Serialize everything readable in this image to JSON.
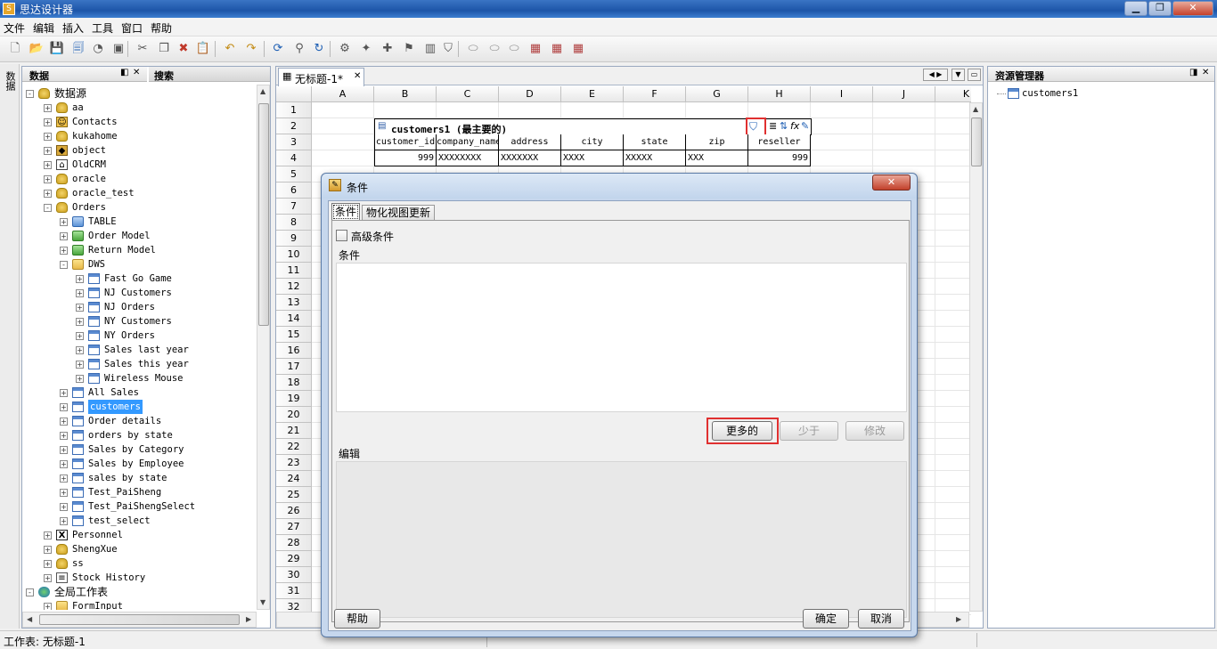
{
  "window": {
    "title": "思达设计器"
  },
  "menu": [
    "文件",
    "编辑",
    "插入",
    "工具",
    "窗口",
    "帮助"
  ],
  "toolbar_icons": [
    "new-file-icon",
    "open-folder-icon",
    "save-icon",
    "save-all-icon",
    "preview-icon",
    "print-icon",
    "cut-icon",
    "copy-icon",
    "delete-icon",
    "paste-icon",
    "undo-icon",
    "redo-icon",
    "refresh-icon",
    "tree-icon",
    "reload-icon",
    "fx-icon",
    "wizard-icon",
    "add-icon",
    "filter-icon",
    "chart-icon",
    "funnel-icon",
    "pill-icon",
    "pill-icon",
    "pill-icon",
    "grid-icon",
    "grid-icon",
    "grid-icon"
  ],
  "vtab": "数据",
  "left_panel": {
    "tab_data": "数据",
    "tab_search": "搜索",
    "tree": [
      {
        "label": "数据源",
        "level": 0,
        "icon": "db",
        "exp": "-"
      },
      {
        "label": "aa",
        "level": 1,
        "icon": "db",
        "exp": "+"
      },
      {
        "label": "Contacts",
        "level": 1,
        "icon": "contacts",
        "exp": "+"
      },
      {
        "label": "kukahome",
        "level": 1,
        "icon": "db",
        "exp": "+"
      },
      {
        "label": "object",
        "level": 1,
        "icon": "object",
        "exp": "+"
      },
      {
        "label": "OldCRM",
        "level": 1,
        "icon": "crm",
        "exp": "+"
      },
      {
        "label": "oracle",
        "level": 1,
        "icon": "db",
        "exp": "+"
      },
      {
        "label": "oracle_test",
        "level": 1,
        "icon": "db",
        "exp": "+"
      },
      {
        "label": "Orders",
        "level": 1,
        "icon": "db",
        "exp": "-"
      },
      {
        "label": "TABLE",
        "level": 2,
        "icon": "bfold",
        "exp": "+"
      },
      {
        "label": "Order Model",
        "level": 2,
        "icon": "gfold",
        "exp": "+"
      },
      {
        "label": "Return Model",
        "level": 2,
        "icon": "gfold",
        "exp": "+"
      },
      {
        "label": "DWS",
        "level": 2,
        "icon": "fold",
        "exp": "-"
      },
      {
        "label": "Fast Go Game",
        "level": 3,
        "icon": "tbl",
        "exp": "+"
      },
      {
        "label": "NJ Customers",
        "level": 3,
        "icon": "tbl",
        "exp": "+"
      },
      {
        "label": "NJ Orders",
        "level": 3,
        "icon": "tbl",
        "exp": "+"
      },
      {
        "label": "NY Customers",
        "level": 3,
        "icon": "tbl",
        "exp": "+"
      },
      {
        "label": "NY Orders",
        "level": 3,
        "icon": "tbl",
        "exp": "+"
      },
      {
        "label": "Sales last year",
        "level": 3,
        "icon": "tbl",
        "exp": "+"
      },
      {
        "label": "Sales this year",
        "level": 3,
        "icon": "tbl",
        "exp": "+"
      },
      {
        "label": "Wireless Mouse",
        "level": 3,
        "icon": "tbl",
        "exp": "+"
      },
      {
        "label": "All Sales",
        "level": 2,
        "icon": "tbl",
        "exp": "+"
      },
      {
        "label": "customers",
        "level": 2,
        "icon": "tbl",
        "exp": "+",
        "selected": true
      },
      {
        "label": "Order details",
        "level": 2,
        "icon": "tbl",
        "exp": "+"
      },
      {
        "label": "orders by state",
        "level": 2,
        "icon": "tbl",
        "exp": "+"
      },
      {
        "label": "Sales by Category",
        "level": 2,
        "icon": "tbl",
        "exp": "+"
      },
      {
        "label": "Sales by Employee",
        "level": 2,
        "icon": "tbl",
        "exp": "+"
      },
      {
        "label": "sales by state",
        "level": 2,
        "icon": "tbl",
        "exp": "+"
      },
      {
        "label": "Test_PaiSheng",
        "level": 2,
        "icon": "tbl",
        "exp": "+"
      },
      {
        "label": "Test_PaiShengSelect",
        "level": 2,
        "icon": "tbl",
        "exp": "+"
      },
      {
        "label": "test_select",
        "level": 2,
        "icon": "tbl",
        "exp": "+"
      },
      {
        "label": "Personnel",
        "level": 1,
        "icon": "x",
        "exp": "+"
      },
      {
        "label": "ShengXue",
        "level": 1,
        "icon": "db",
        "exp": "+"
      },
      {
        "label": "ss",
        "level": 1,
        "icon": "db",
        "exp": "+"
      },
      {
        "label": "Stock History",
        "level": 1,
        "icon": "doc",
        "exp": "+"
      },
      {
        "label": "全局工作表",
        "level": 0,
        "icon": "globe",
        "exp": "-"
      },
      {
        "label": "FormInput",
        "level": 1,
        "icon": "fold",
        "exp": "+"
      }
    ]
  },
  "center": {
    "tab_label": "无标题-1*",
    "columns": [
      "A",
      "B",
      "C",
      "D",
      "E",
      "F",
      "G",
      "H",
      "I",
      "J",
      "K"
    ],
    "rows": [
      "1",
      "2",
      "3",
      "4",
      "5",
      "6",
      "7",
      "8",
      "9",
      "10",
      "11",
      "12",
      "13",
      "14",
      "15",
      "16",
      "17",
      "18",
      "19",
      "20",
      "21",
      "22",
      "23",
      "24",
      "25",
      "26",
      "27",
      "28",
      "29",
      "30",
      "31",
      "32"
    ],
    "table_title": "customers1 (最主要的)",
    "headers": [
      "customer_id",
      "company_name",
      "address",
      "city",
      "state",
      "zip",
      "reseller"
    ],
    "values": [
      "999",
      "XXXXXXXX",
      "XXXXXXX",
      "XXXX",
      "XXXXX",
      "XXX",
      "999"
    ]
  },
  "right_panel": {
    "title": "资源管理器",
    "items": [
      "customers1"
    ]
  },
  "status": {
    "text": "工作表: 无标题-1"
  },
  "dialog": {
    "title": "条件",
    "tabs": [
      "条件",
      "物化视图更新"
    ],
    "advanced_checkbox": "高级条件",
    "condition_label": "条件",
    "edit_label": "编辑",
    "btn_more": "更多的",
    "btn_less": "少于",
    "btn_modify": "修改",
    "btn_help": "帮助",
    "btn_ok": "确定",
    "btn_cancel": "取消"
  },
  "colors": {
    "accent": "#3399ff",
    "highlight": "#e03030",
    "titlebar": "#1d55a8"
  }
}
